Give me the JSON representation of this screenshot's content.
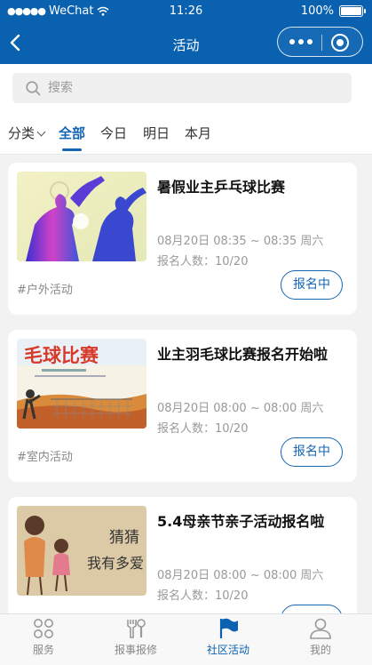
{
  "status_bar": {
    "carrier": "WeChat",
    "time": "11:26",
    "battery": "100%"
  },
  "nav": {
    "title": "活动"
  },
  "search": {
    "placeholder": "搜索"
  },
  "filter_tabs": {
    "category": "分类",
    "items": [
      {
        "label": "全部",
        "active": true
      },
      {
        "label": "今日",
        "active": false
      },
      {
        "label": "明日",
        "active": false
      },
      {
        "label": "本月",
        "active": false
      }
    ]
  },
  "activities": [
    {
      "title": "暑假业主乒乓球比赛",
      "time": "08月20日 08:35 ~ 08:35 周六",
      "count": "报名人数：10/20",
      "tag": "#户外活动",
      "button": "报名中",
      "image_icon": "table-tennis-silhouette-image"
    },
    {
      "title": "业主羽毛球比赛报名开始啦",
      "time": "08月20日 08:00 ~ 08:00 周六",
      "count": "报名人数：10/20",
      "tag": "#室内活动",
      "button": "报名中",
      "image_icon": "badminton-poster-image",
      "image_text": "毛球比赛"
    },
    {
      "title": "5.4母亲节亲子活动报名啦",
      "time": "08月20日 08:00 ~ 08:00 周六",
      "count": "报名人数：10/20",
      "tag": "",
      "button": "",
      "image_icon": "mother-child-illustration-image",
      "image_text_1": "猜猜",
      "image_text_2": "我有多爱"
    }
  ],
  "tabbar": [
    {
      "label": "服务",
      "icon": "grid-icon",
      "active": false
    },
    {
      "label": "报事报修",
      "icon": "tools-icon",
      "active": false
    },
    {
      "label": "社区活动",
      "icon": "flag-icon",
      "active": true
    },
    {
      "label": "我的",
      "icon": "user-icon",
      "active": false
    }
  ],
  "colors": {
    "primary": "#0a61b0",
    "accent": "#1565b4",
    "background": "#f2f2f2"
  }
}
